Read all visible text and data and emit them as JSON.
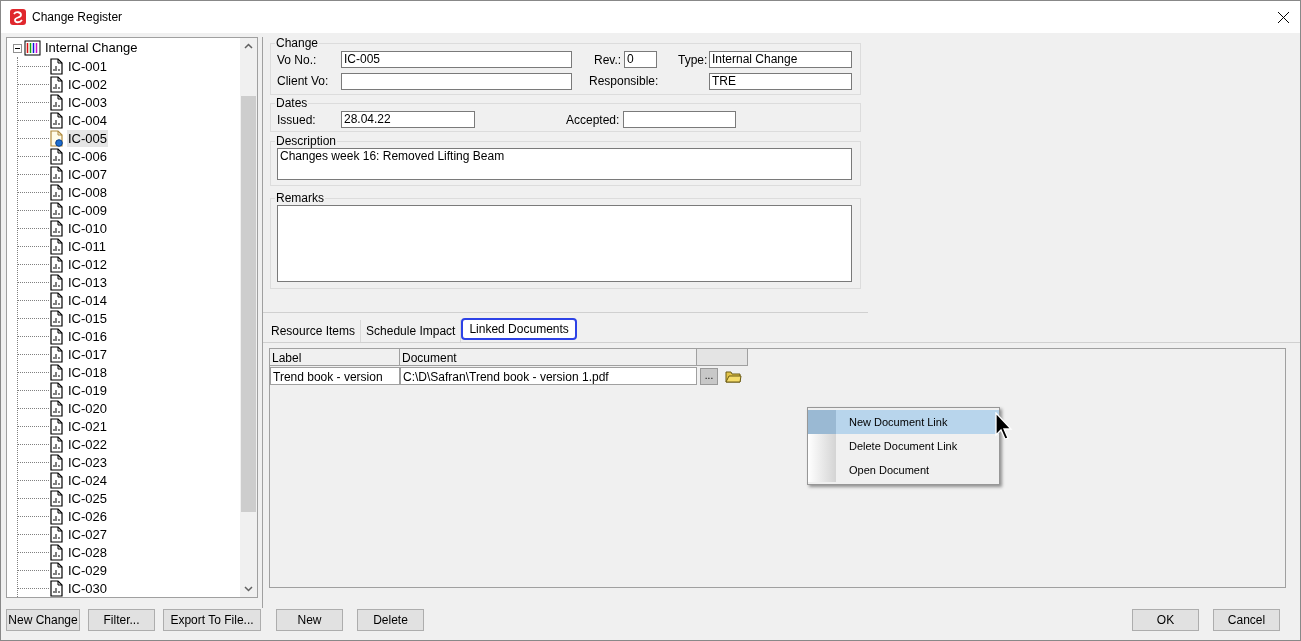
{
  "window": {
    "title": "Change Register"
  },
  "tree": {
    "label": "Internal Change",
    "expanded": true,
    "children": [
      {
        "label": "IC-001",
        "selected": false
      },
      {
        "label": "IC-002",
        "selected": false
      },
      {
        "label": "IC-003",
        "selected": false
      },
      {
        "label": "IC-004",
        "selected": false
      },
      {
        "label": "IC-005",
        "selected": true
      },
      {
        "label": "IC-006",
        "selected": false
      },
      {
        "label": "IC-007",
        "selected": false
      },
      {
        "label": "IC-008",
        "selected": false
      },
      {
        "label": "IC-009",
        "selected": false
      },
      {
        "label": "IC-010",
        "selected": false
      },
      {
        "label": "IC-011",
        "selected": false
      },
      {
        "label": "IC-012",
        "selected": false
      },
      {
        "label": "IC-013",
        "selected": false
      },
      {
        "label": "IC-014",
        "selected": false
      },
      {
        "label": "IC-015",
        "selected": false
      },
      {
        "label": "IC-016",
        "selected": false
      },
      {
        "label": "IC-017",
        "selected": false
      },
      {
        "label": "IC-018",
        "selected": false
      },
      {
        "label": "IC-019",
        "selected": false
      },
      {
        "label": "IC-020",
        "selected": false
      },
      {
        "label": "IC-021",
        "selected": false
      },
      {
        "label": "IC-022",
        "selected": false
      },
      {
        "label": "IC-023",
        "selected": false
      },
      {
        "label": "IC-024",
        "selected": false
      },
      {
        "label": "IC-025",
        "selected": false
      },
      {
        "label": "IC-026",
        "selected": false
      },
      {
        "label": "IC-027",
        "selected": false
      },
      {
        "label": "IC-028",
        "selected": false
      },
      {
        "label": "IC-029",
        "selected": false
      },
      {
        "label": "IC-030",
        "selected": false
      }
    ]
  },
  "change": {
    "title": "Change",
    "vo_no": {
      "label": "Vo No.:",
      "value": "IC-005"
    },
    "rev": {
      "label": "Rev.:",
      "value": "0"
    },
    "type": {
      "label": "Type:",
      "value": "Internal Change"
    },
    "client_vo": {
      "label": "Client Vo:"
    },
    "responsible": {
      "label": "Responsible:",
      "value": "TRE"
    }
  },
  "dates": {
    "title": "Dates",
    "issued": {
      "label": "Issued:",
      "value": "28.04.22"
    },
    "accepted": {
      "label": "Accepted:"
    }
  },
  "description": {
    "title": "Description",
    "value": "Changes week 16: Removed Lifting Beam"
  },
  "remarks": {
    "title": "Remarks"
  },
  "tabs": [
    {
      "label": "Resource Items",
      "selected": false
    },
    {
      "label": "Schedule Impact",
      "selected": false
    },
    {
      "label": "Linked Documents",
      "selected": true
    }
  ],
  "table": {
    "columns": [
      "Label",
      "Document"
    ],
    "rows": [
      {
        "label": "Trend book - version",
        "document": "C:\\D\\Safran\\Trend book - version 1.pdf",
        "browse": "..."
      }
    ]
  },
  "context_menu": [
    {
      "label": "New Document Link",
      "selected": true
    },
    {
      "label": "Delete Document Link",
      "selected": false
    },
    {
      "label": "Open Document",
      "selected": false
    }
  ],
  "buttons_left": [
    "New Change",
    "Filter...",
    "Export To File..."
  ],
  "buttons_middle": [
    "New",
    "Delete"
  ],
  "buttons_right": [
    "OK",
    "Cancel"
  ]
}
